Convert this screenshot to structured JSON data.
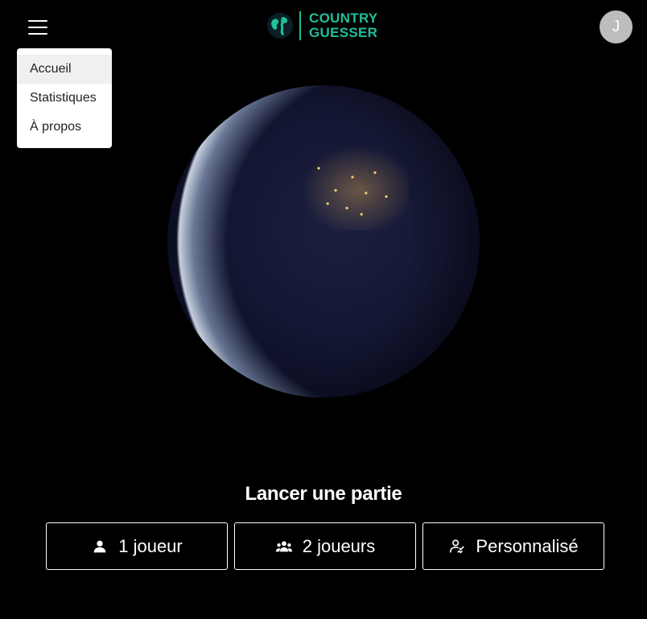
{
  "brand": {
    "line1": "COUNTRY",
    "line2": "GUESSER",
    "accent": "#1fbf9a"
  },
  "user": {
    "initial": "J"
  },
  "menu": {
    "items": [
      {
        "label": "Accueil"
      },
      {
        "label": "Statistiques"
      },
      {
        "label": "À propos"
      }
    ]
  },
  "play": {
    "title": "Lancer une partie",
    "modes": [
      {
        "label": "1 joueur",
        "icon": "person-icon"
      },
      {
        "label": "2 joueurs",
        "icon": "group-icon"
      },
      {
        "label": "Personnalisé",
        "icon": "custom-players-icon"
      }
    ]
  }
}
